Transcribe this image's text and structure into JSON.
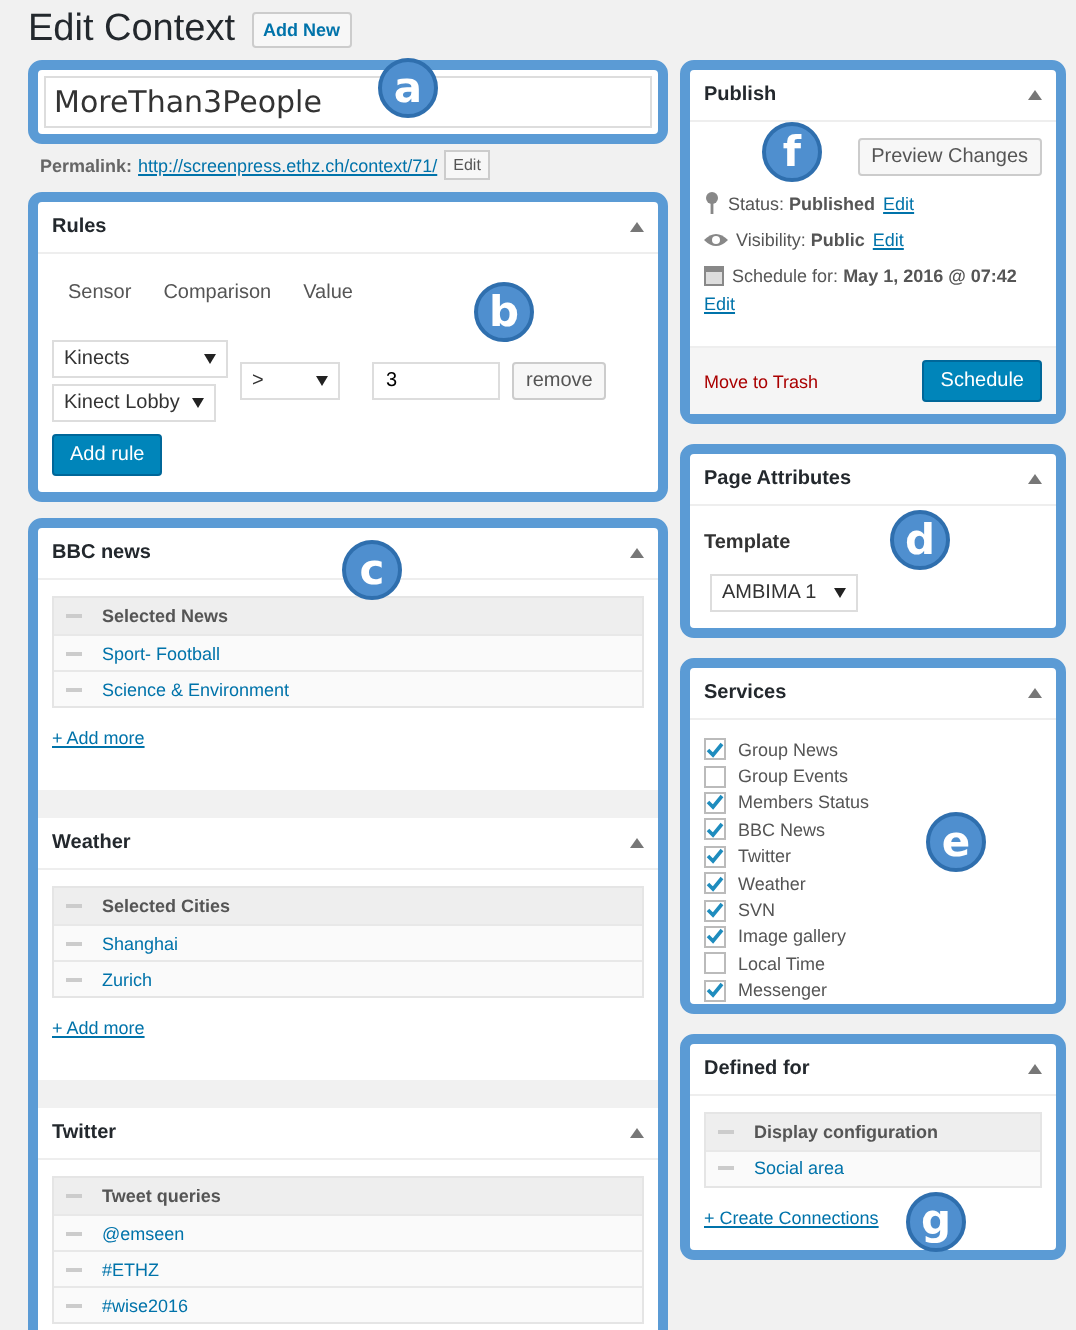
{
  "header": {
    "title": "Edit Context",
    "add_new": "Add New"
  },
  "title_field": {
    "value": "MoreThan3People",
    "callout": "a"
  },
  "permalink": {
    "label": "Permalink:",
    "url": "http://screenpress.ethz.ch/context/71/",
    "edit": "Edit"
  },
  "rules": {
    "title": "Rules",
    "callout": "b",
    "columns": [
      "Sensor",
      "Comparison",
      "Value"
    ],
    "sensor": [
      "Kinects",
      "Kinect Lobby"
    ],
    "comparison": ">",
    "value": "3",
    "remove": "remove",
    "add_rule": "Add rule"
  },
  "service_settings": {
    "callout": "c",
    "panels": [
      {
        "title": "BBC news",
        "header": "Selected News",
        "items": [
          "Sport- Football",
          "Science & Environment"
        ],
        "add_more": "+ Add more"
      },
      {
        "title": "Weather",
        "header": "Selected Cities",
        "items": [
          "Shanghai",
          "Zurich"
        ],
        "add_more": "+ Add more"
      },
      {
        "title": "Twitter",
        "header": "Tweet queries",
        "items": [
          "@emseen",
          "#ETHZ",
          "#wise2016"
        ]
      }
    ]
  },
  "publish": {
    "title": "Publish",
    "callout": "f",
    "preview": "Preview Changes",
    "rows": [
      {
        "kind": "status",
        "label": "Status:",
        "value": "Published",
        "edit": "Edit"
      },
      {
        "kind": "visibility",
        "label": "Visibility:",
        "value": "Public",
        "edit": "Edit"
      },
      {
        "kind": "schedule",
        "label": "Schedule for:",
        "value": "May 1, 2016 @ 07:42",
        "edit": "Edit"
      }
    ],
    "trash": "Move to Trash",
    "schedule": "Schedule"
  },
  "page_attributes": {
    "title": "Page Attributes",
    "callout": "d",
    "template_label": "Template",
    "template": "AMBIMA 1"
  },
  "services": {
    "title": "Services",
    "callout": "e",
    "items": [
      {
        "label": "Group News",
        "checked": true
      },
      {
        "label": "Group Events",
        "checked": false
      },
      {
        "label": "Members Status",
        "checked": true
      },
      {
        "label": "BBC News",
        "checked": true
      },
      {
        "label": "Twitter",
        "checked": true
      },
      {
        "label": "Weather",
        "checked": true
      },
      {
        "label": "SVN",
        "checked": true
      },
      {
        "label": "Image gallery",
        "checked": true
      },
      {
        "label": "Local Time",
        "checked": false
      },
      {
        "label": "Messenger",
        "checked": true
      }
    ]
  },
  "defined_for": {
    "title": "Defined for",
    "callout": "g",
    "header": "Display configuration",
    "items": [
      "Social area"
    ],
    "create": "+ Create Connections"
  }
}
